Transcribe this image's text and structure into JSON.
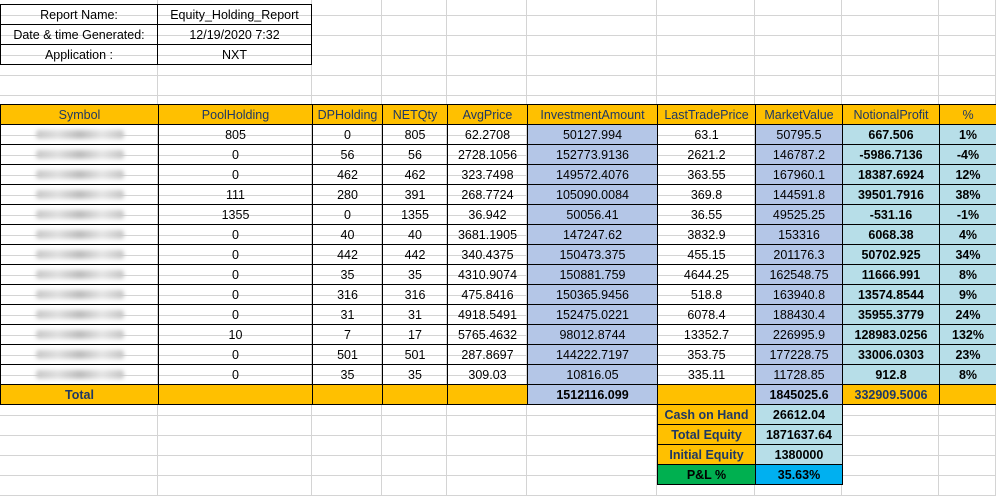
{
  "meta": {
    "report_name_label": "Report Name:",
    "report_name_value": "Equity_Holding_Report",
    "datetime_label": "Date & time Generated:",
    "datetime_value": "12/19/2020 7:32",
    "application_label": "Application :",
    "application_value": "NXT"
  },
  "table": {
    "headers": [
      "Symbol",
      "PoolHolding",
      "DPHolding",
      "NETQty",
      "AvgPrice",
      "InvestmentAmount",
      "LastTradePrice",
      "MarketValue",
      "NotionalProfit",
      "%"
    ],
    "rows": [
      [
        "",
        "805",
        "0",
        "805",
        "62.2708",
        "50127.994",
        "63.1",
        "50795.5",
        "667.506",
        "1%"
      ],
      [
        "",
        "0",
        "56",
        "56",
        "2728.1056",
        "152773.9136",
        "2621.2",
        "146787.2",
        "-5986.7136",
        "-4%"
      ],
      [
        "",
        "0",
        "462",
        "462",
        "323.7498",
        "149572.4076",
        "363.55",
        "167960.1",
        "18387.6924",
        "12%"
      ],
      [
        "",
        "111",
        "280",
        "391",
        "268.7724",
        "105090.0084",
        "369.8",
        "144591.8",
        "39501.7916",
        "38%"
      ],
      [
        "",
        "1355",
        "0",
        "1355",
        "36.942",
        "50056.41",
        "36.55",
        "49525.25",
        "-531.16",
        "-1%"
      ],
      [
        "",
        "0",
        "40",
        "40",
        "3681.1905",
        "147247.62",
        "3832.9",
        "153316",
        "6068.38",
        "4%"
      ],
      [
        "",
        "0",
        "442",
        "442",
        "340.4375",
        "150473.375",
        "455.15",
        "201176.3",
        "50702.925",
        "34%"
      ],
      [
        "",
        "0",
        "35",
        "35",
        "4310.9074",
        "150881.759",
        "4644.25",
        "162548.75",
        "11666.991",
        "8%"
      ],
      [
        "",
        "0",
        "316",
        "316",
        "475.8416",
        "150365.9456",
        "518.8",
        "163940.8",
        "13574.8544",
        "9%"
      ],
      [
        "",
        "0",
        "31",
        "31",
        "4918.5491",
        "152475.0221",
        "6078.4",
        "188430.4",
        "35955.3779",
        "24%"
      ],
      [
        "",
        "10",
        "7",
        "17",
        "5765.4632",
        "98012.8744",
        "13352.7",
        "226995.9",
        "128983.0256",
        "132%"
      ],
      [
        "",
        "0",
        "501",
        "501",
        "287.8697",
        "144222.7197",
        "353.75",
        "177228.75",
        "33006.0303",
        "23%"
      ],
      [
        "",
        "0",
        "35",
        "35",
        "309.03",
        "10816.05",
        "335.11",
        "11728.85",
        "912.8",
        "8%"
      ]
    ],
    "total": {
      "label": "Total",
      "investment": "1512116.099",
      "market_value": "1845025.6",
      "notional_profit": "332909.5006"
    }
  },
  "summary": [
    {
      "label": "Cash on Hand",
      "value": "26612.04"
    },
    {
      "label": "Total Equity",
      "value": "1871637.64"
    },
    {
      "label": "Initial Equity",
      "value": "1380000"
    },
    {
      "label": "P&L %",
      "value": "35.63%"
    }
  ],
  "colors": {
    "header_bg": "#ffc000",
    "investment_bg": "#b4c6e7",
    "profit_bg": "#b7dee8",
    "pl_label_bg": "#00b050",
    "pl_value_bg": "#00b0f0"
  }
}
